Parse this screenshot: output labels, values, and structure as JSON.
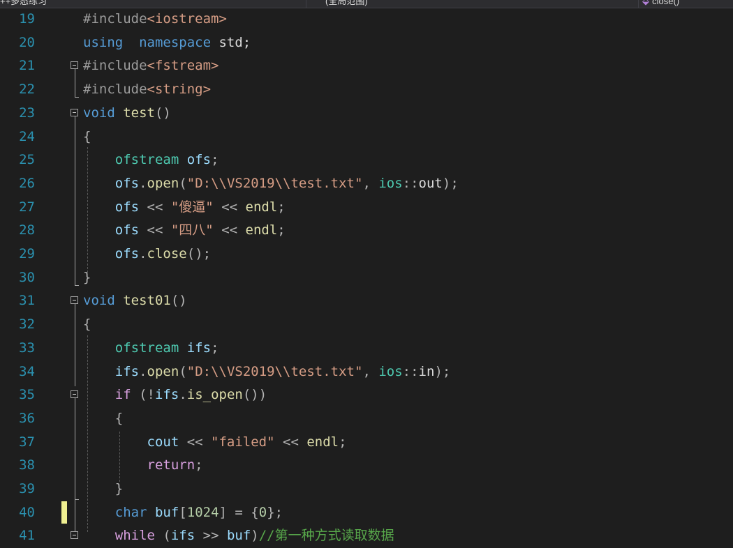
{
  "navbar": {
    "project": "++多态练习",
    "scope": "(全局范围)",
    "member": "close()"
  },
  "lines": [
    {
      "n": "19",
      "toks": [
        [
          "pp",
          "#include"
        ],
        [
          "inc",
          "<iostream>"
        ]
      ]
    },
    {
      "n": "20",
      "toks": [
        [
          "kw",
          "using"
        ],
        [
          "",
          "  "
        ],
        [
          "kw",
          "namespace"
        ],
        [
          "",
          ""
        ],
        [
          "",
          " std;"
        ]
      ]
    },
    {
      "n": "21",
      "toks": [
        [
          "pp",
          "#include"
        ],
        [
          "inc",
          "<fstream>"
        ]
      ]
    },
    {
      "n": "22",
      "toks": [
        [
          "pp",
          "#include"
        ],
        [
          "inc",
          "<string>"
        ]
      ]
    },
    {
      "n": "23",
      "toks": [
        [
          "kw",
          "void"
        ],
        [
          "",
          " "
        ],
        [
          "fn",
          "test"
        ],
        [
          "op",
          "()"
        ]
      ]
    },
    {
      "n": "24",
      "toks": [
        [
          "op",
          "{"
        ]
      ]
    },
    {
      "n": "25",
      "toks": [
        [
          "",
          "    "
        ],
        [
          "ty",
          "ofstream"
        ],
        [
          "",
          " "
        ],
        [
          "vr",
          "ofs"
        ],
        [
          "op",
          ";"
        ]
      ]
    },
    {
      "n": "26",
      "toks": [
        [
          "",
          "    "
        ],
        [
          "vr",
          "ofs"
        ],
        [
          "op",
          "."
        ],
        [
          "fn",
          "open"
        ],
        [
          "op",
          "("
        ],
        [
          "st",
          "\"D:\\\\VS2019\\\\test.txt\""
        ],
        [
          "op",
          ", "
        ],
        [
          "ns",
          "ios"
        ],
        [
          "op",
          "::"
        ],
        [
          "",
          "out"
        ],
        [
          "op",
          ");"
        ]
      ]
    },
    {
      "n": "27",
      "toks": [
        [
          "",
          "    "
        ],
        [
          "vr",
          "ofs"
        ],
        [
          "op",
          " << "
        ],
        [
          "st",
          "\"傻逼\""
        ],
        [
          "op",
          " << "
        ],
        [
          "fn",
          "endl"
        ],
        [
          "op",
          ";"
        ]
      ]
    },
    {
      "n": "28",
      "toks": [
        [
          "",
          "    "
        ],
        [
          "vr",
          "ofs"
        ],
        [
          "op",
          " << "
        ],
        [
          "st",
          "\"四八\""
        ],
        [
          "op",
          " << "
        ],
        [
          "fn",
          "endl"
        ],
        [
          "op",
          ";"
        ]
      ]
    },
    {
      "n": "29",
      "toks": [
        [
          "",
          "    "
        ],
        [
          "vr",
          "ofs"
        ],
        [
          "op",
          "."
        ],
        [
          "fn",
          "close"
        ],
        [
          "op",
          "();"
        ]
      ]
    },
    {
      "n": "30",
      "toks": [
        [
          "op",
          "}"
        ]
      ]
    },
    {
      "n": "31",
      "toks": [
        [
          "kw",
          "void"
        ],
        [
          "",
          " "
        ],
        [
          "fn",
          "test01"
        ],
        [
          "op",
          "()"
        ]
      ]
    },
    {
      "n": "32",
      "toks": [
        [
          "op",
          "{"
        ]
      ]
    },
    {
      "n": "33",
      "toks": [
        [
          "",
          "    "
        ],
        [
          "ty",
          "ofstream"
        ],
        [
          "",
          " "
        ],
        [
          "vr",
          "ifs"
        ],
        [
          "op",
          ";"
        ]
      ]
    },
    {
      "n": "34",
      "toks": [
        [
          "",
          "    "
        ],
        [
          "vr",
          "ifs"
        ],
        [
          "op",
          "."
        ],
        [
          "fn",
          "open"
        ],
        [
          "op",
          "("
        ],
        [
          "st",
          "\"D:\\\\VS2019\\\\test.txt\""
        ],
        [
          "op",
          ", "
        ],
        [
          "ns",
          "ios"
        ],
        [
          "op",
          "::"
        ],
        [
          "",
          "in"
        ],
        [
          "op",
          ");"
        ]
      ]
    },
    {
      "n": "35",
      "toks": [
        [
          "",
          "    "
        ],
        [
          "ck",
          "if"
        ],
        [
          "op",
          " (!"
        ],
        [
          "vr",
          "ifs"
        ],
        [
          "op",
          "."
        ],
        [
          "fn",
          "is_open"
        ],
        [
          "op",
          "())"
        ]
      ]
    },
    {
      "n": "36",
      "toks": [
        [
          "",
          "    "
        ],
        [
          "op",
          "{"
        ]
      ]
    },
    {
      "n": "37",
      "toks": [
        [
          "",
          "        "
        ],
        [
          "vr",
          "cout"
        ],
        [
          "op",
          " << "
        ],
        [
          "st",
          "\"failed\""
        ],
        [
          "op",
          " << "
        ],
        [
          "fn",
          "endl"
        ],
        [
          "op",
          ";"
        ]
      ]
    },
    {
      "n": "38",
      "toks": [
        [
          "",
          "        "
        ],
        [
          "ck",
          "return"
        ],
        [
          "op",
          ";"
        ]
      ]
    },
    {
      "n": "39",
      "toks": [
        [
          "",
          "    "
        ],
        [
          "op",
          "}"
        ]
      ]
    },
    {
      "n": "40",
      "toks": [
        [
          "",
          "    "
        ],
        [
          "kw",
          "char"
        ],
        [
          "",
          " "
        ],
        [
          "vr",
          "buf"
        ],
        [
          "op",
          "["
        ],
        [
          "nm",
          "1024"
        ],
        [
          "op",
          "] = {"
        ],
        [
          "nm",
          "0"
        ],
        [
          "op",
          "};"
        ]
      ]
    },
    {
      "n": "41",
      "toks": [
        [
          "",
          "    "
        ],
        [
          "ck",
          "while"
        ],
        [
          "op",
          " ("
        ],
        [
          "vr",
          "ifs"
        ],
        [
          "op",
          " >> "
        ],
        [
          "vr",
          "buf"
        ],
        [
          "op",
          ")"
        ],
        [
          "cm",
          "//第一种方式读取数据"
        ]
      ]
    }
  ]
}
